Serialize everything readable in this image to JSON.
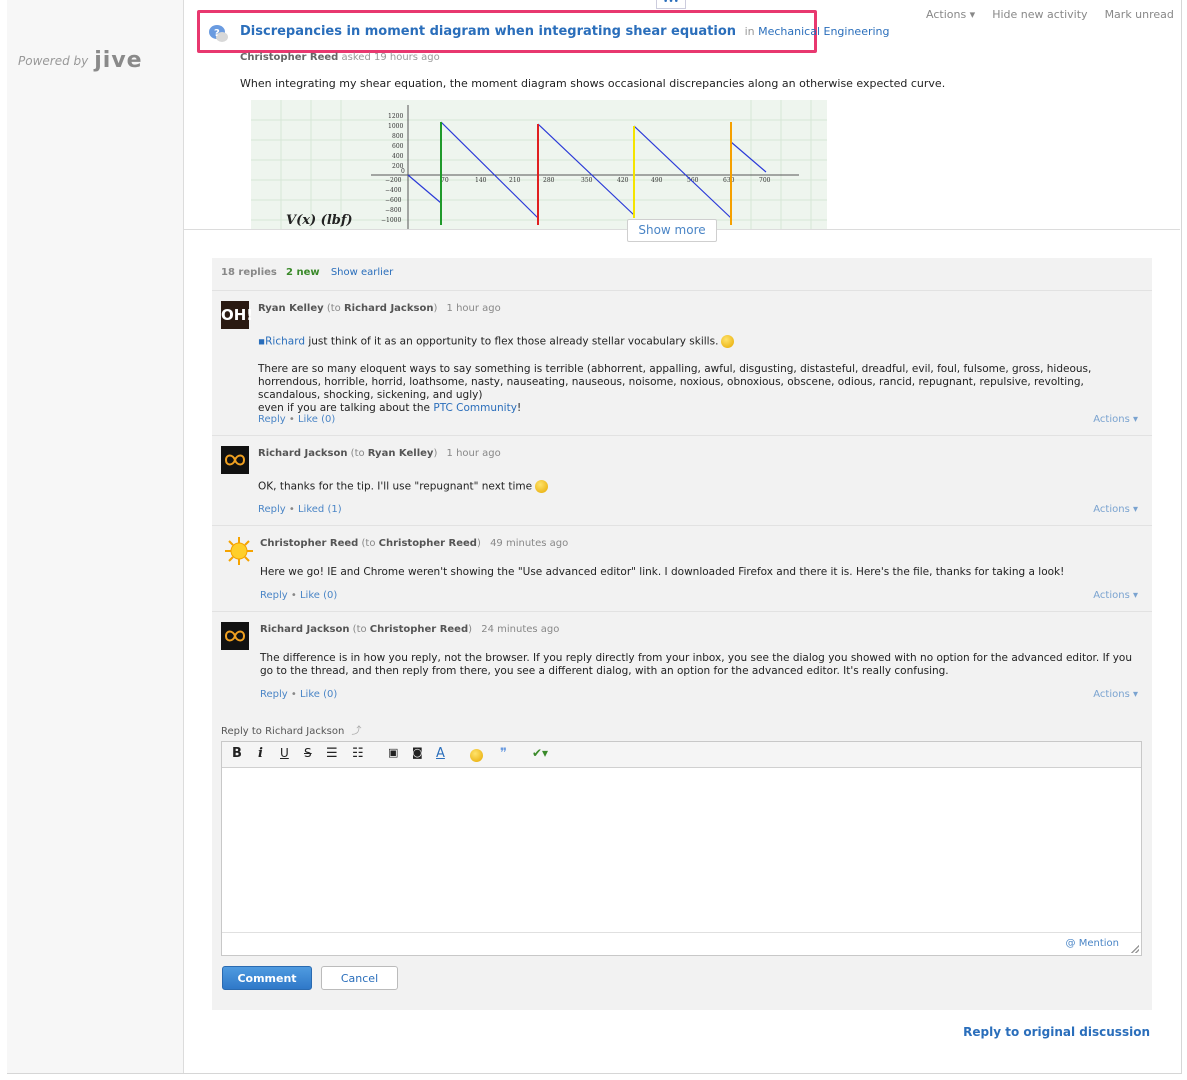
{
  "sidebar": {
    "powered_by": "Powered by",
    "logo": "jive"
  },
  "discussion": {
    "title": "Discrepancies in moment diagram when integrating shear equation",
    "in_label": "in",
    "category": "Mechanical Engineering",
    "author": "Christopher Reed",
    "asked": "asked 19 hours ago",
    "question": "When integrating my shear equation, the moment diagram shows occasional discrepancies along an otherwise expected curve.",
    "plot_label": "V(x) (lbf)",
    "show_more": "Show more",
    "more_dots": "•••"
  },
  "top_actions": {
    "actions": "Actions ▾",
    "hide": "Hide new activity",
    "unread": "Mark unread"
  },
  "thread": {
    "replies": "18 replies",
    "new": "2 new",
    "show_earlier": "Show earlier"
  },
  "replies": [
    {
      "avatar": "OH!",
      "author": "Ryan Kelley",
      "to": "Richard Jackson",
      "time": "1 hour ago",
      "mention": "Richard",
      "line1": " just think of it as an opportunity to flex those already stellar vocabulary skills.",
      "para": "There are so many eloquent ways to say something is terrible (abhorrent, appalling, awful, disgusting, distasteful, dreadful, evil, foul, fulsome, gross, hideous, horrendous, horrible, horrid, loathsome, nasty, nauseating, nauseous, noisome, noxious, obnoxious, obscene, odious, rancid, repugnant, repulsive, revolting, scandalous, shocking, sickening, and ugly)",
      "para2": "even if you are talking about the ",
      "para2_link": "PTC Community",
      "para2_end": "!",
      "reply": "Reply",
      "like": "Like (0)",
      "actions": "Actions ▾"
    },
    {
      "author": "Richard Jackson",
      "to": "Ryan Kelley",
      "time": "1 hour ago",
      "body": "OK, thanks for the tip. I'll use \"repugnant\" next time",
      "reply": "Reply",
      "like": "Liked (1)",
      "actions": "Actions ▾"
    },
    {
      "author": "Christopher Reed",
      "to": "Christopher Reed",
      "time": "49 minutes ago",
      "body": "Here we go! IE and Chrome weren't showing the \"Use advanced editor\" link. I downloaded Firefox and there it is. Here's the file, thanks for taking a look!",
      "reply": "Reply",
      "like": "Like (0)",
      "actions": "Actions ▾"
    },
    {
      "author": "Richard Jackson",
      "to": "Christopher Reed",
      "time": "24 minutes ago",
      "body": "The difference is in how you reply, not the browser. If you reply directly from your inbox, you see the dialog you showed with no option for the advanced editor. If you go to the thread, and then reply from there, you see a different dialog, with an option for the advanced editor. It's really confusing.",
      "reply": "Reply",
      "like": "Like (0)",
      "actions": "Actions ▾"
    }
  ],
  "labels": {
    "to_prefix": "(to ",
    "to_suffix": ")",
    "bullet": "•"
  },
  "composer": {
    "reply_to_label": "Reply to",
    "reply_to_name": "Richard Jackson",
    "mention": "@ Mention",
    "comment": "Comment",
    "cancel": "Cancel"
  },
  "footer": {
    "reply_original": "Reply to original discussion"
  },
  "colors": {
    "accent": "#2a6ebb",
    "highlight_border": "#e8386f",
    "new_badge": "#3a8a2a"
  }
}
